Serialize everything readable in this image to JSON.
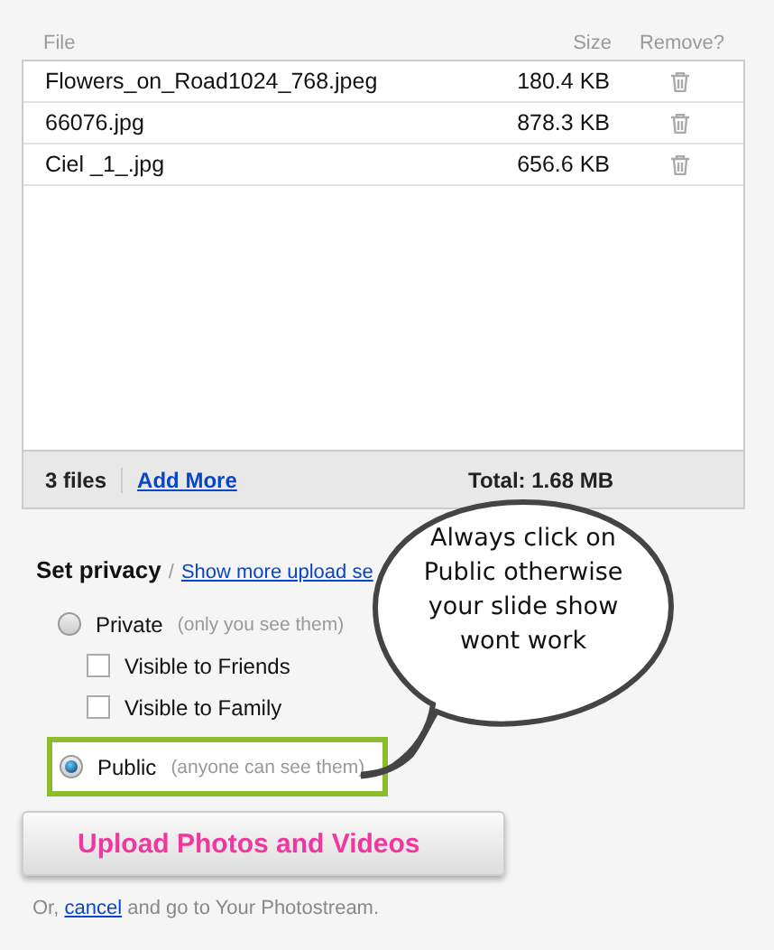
{
  "table": {
    "columns": [
      "File",
      "Size",
      "Remove?"
    ],
    "rows": [
      {
        "file": "Flowers_on_Road1024_768.jpeg",
        "size": "180.4 KB"
      },
      {
        "file": "66076.jpg",
        "size": "878.3 KB"
      },
      {
        "file": "Ciel _1_.jpg",
        "size": "656.6 KB"
      }
    ],
    "footer": {
      "count": "3 files",
      "add_more": "Add More",
      "total": "Total: 1.68 MB"
    }
  },
  "privacy": {
    "title": "Set privacy",
    "separator": "/",
    "link": "Show more upload se",
    "options": [
      {
        "kind": "radio",
        "label": "Private",
        "hint": "(only you see them)",
        "selected": false,
        "highlighted": false
      },
      {
        "kind": "checkbox",
        "label": "Visible to Friends",
        "checked": false
      },
      {
        "kind": "checkbox",
        "label": "Visible to Family",
        "checked": false
      },
      {
        "kind": "radio",
        "label": "Public",
        "hint": "(anyone can see them)",
        "selected": true,
        "highlighted": true
      }
    ]
  },
  "upload_button": "Upload Photos and Videos",
  "footer_note": {
    "before": "Or,",
    "link": "cancel",
    "after": "and go to Your Photostream."
  },
  "callout": "Always click on Public otherwise your slide show wont work"
}
